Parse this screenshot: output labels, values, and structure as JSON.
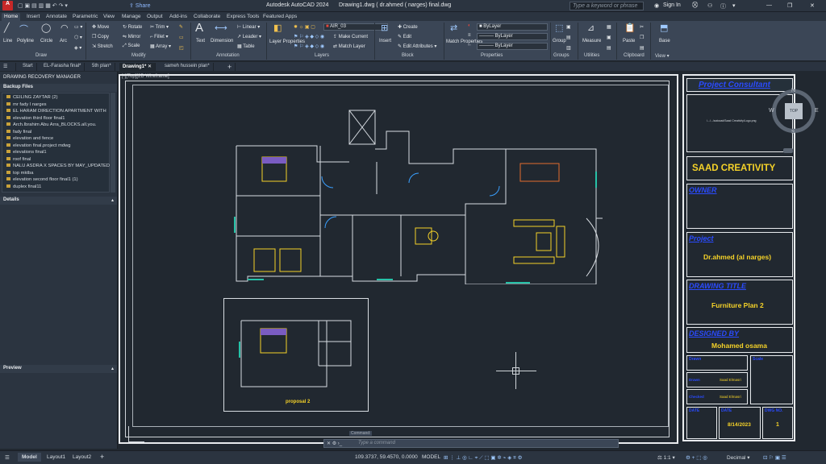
{
  "app": {
    "title": "Autodesk AutoCAD 2024",
    "file": "Drawing1.dwg ( dr.ahmed ( narges) final.dwg",
    "share": "Share",
    "search_placeholder": "Type a keyword or phrase",
    "signin": "Sign In"
  },
  "ribbon_tabs": [
    "Home",
    "Insert",
    "Annotate",
    "Parametric",
    "View",
    "Manage",
    "Output",
    "Add-ins",
    "Collaborate",
    "Express Tools",
    "Featured Apps"
  ],
  "draw": {
    "line": "Line",
    "polyline": "Polyline",
    "circle": "Circle",
    "arc": "Arc",
    "panel": "Draw"
  },
  "modify": {
    "move": "Move",
    "rotate": "Rotate",
    "trim": "Trim",
    "copy": "Copy",
    "mirror": "Mirror",
    "fillet": "Fillet",
    "stretch": "Stretch",
    "scale": "Scale",
    "array": "Array",
    "panel": "Modify"
  },
  "annotation": {
    "text": "Text",
    "dimension": "Dimension",
    "linear": "Linear",
    "leader": "Leader",
    "table": "Table",
    "panel": "Annotation"
  },
  "layers": {
    "properties": "Layer Properties",
    "current": "AIR_03",
    "make_current": "Make Current",
    "match_layer": "Match Layer",
    "panel": "Layers"
  },
  "block": {
    "insert": "Insert",
    "create": "Create",
    "edit": "Edit",
    "edit_attr": "Edit Attributes",
    "panel": "Block"
  },
  "properties": {
    "match": "Match Properties",
    "bylayer": "ByLayer",
    "panel": "Properties"
  },
  "groups": {
    "group": "Group",
    "panel": "Groups"
  },
  "utilities": {
    "measure": "Measure",
    "panel": "Utilities"
  },
  "clipboard": {
    "paste": "Paste",
    "panel": "Clipboard"
  },
  "viewp": {
    "base": "Base",
    "panel": "View"
  },
  "doc_tabs": [
    "Start",
    "EL-Farasha final*",
    "5th plan*",
    "Drawing1*",
    "sameh hussein plan*"
  ],
  "recovery": {
    "title": "DRAWING RECOVERY MANAGER",
    "backup": "Backup Files",
    "details": "Details",
    "preview": "Preview",
    "files": [
      "CEILING ZAYTAR (2)",
      "mr fady l narges",
      "EL HARAM DIRECTION APARTMENT WITH",
      "elevation third floor final1",
      "Arch.Ibrahim Abu Arra_BLOCKS.all.you.",
      "fady final",
      "elevation and fence",
      "elevation final.project mdwg",
      "elevations final1",
      "roof final",
      "NALU ASDRA X SPACES BY MAY_UPDATED",
      "top mktba",
      "elevation second floor final1 (1)",
      "duplex final11"
    ]
  },
  "viewport_label": "[-][Top][2D Wireframe]",
  "viewcube": {
    "top": "TOP",
    "n": "N",
    "s": "S",
    "e": "E",
    "w": "W"
  },
  "titleblock": {
    "consultant_label": "Project Consultant",
    "address": "/.../.../autocad/Saad Creativity/Logo.png",
    "company": "SAAD CREATIVITY",
    "owner_label": "OWNER",
    "project_label": "Project",
    "project": "Dr.ahmed (al narges)",
    "drawing_title_label": "DRAWING TITLE",
    "drawing_title": "Furniture Plan 2",
    "designed_label": "DESIGNED BY",
    "designer": "Mohamed osama",
    "drawn_label": "Drawn",
    "drawn_by": "Saad Elmasri",
    "checked_label": "Checked",
    "checked_by": "Saad Elmasri",
    "scale_label": "Scale",
    "date_label": "DATE",
    "date": "8/14/2023",
    "no_label": "DWG NO.",
    "no": "1"
  },
  "proposal": "proposal 2",
  "command": {
    "placeholder": "Type a command",
    "label": "Command:"
  },
  "status": {
    "model": "Model",
    "layout1": "Layout1",
    "layout2": "Layout2",
    "coords": "109.3737, 59.4570, 0.0000",
    "mode": "MODEL",
    "scale": "1:1",
    "units": "Decimal"
  },
  "colors": {
    "accent": "#f5d228",
    "title_blue": "#2a4bff",
    "line": "#d9dde2"
  }
}
